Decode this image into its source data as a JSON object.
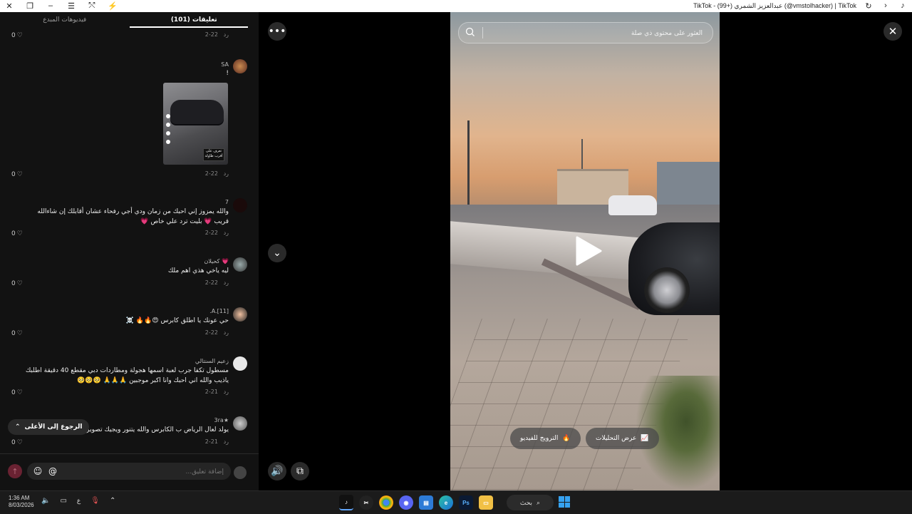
{
  "window": {
    "title": "TikTok - (99+) عبدالعزيز الشمري (@vmstolhacker) | TikTok",
    "buttons": [
      "close",
      "restore",
      "minimize",
      "menu",
      "pin",
      "extension"
    ]
  },
  "comments_panel": {
    "tabs": [
      {
        "label": "(101) تعليقات",
        "active": true
      },
      {
        "label": "فيديوهات المبدع",
        "active": false
      }
    ],
    "comments": [
      {
        "user": "",
        "text": "",
        "date": "2-22",
        "reply": "رد",
        "likes": "0"
      },
      {
        "user": "SA",
        "text": "!",
        "has_image": true,
        "date": "2-22",
        "reply": "رد",
        "likes": "0"
      },
      {
        "user": "7",
        "text": "والله يمزوز إني احبك من زمان ودي أجي رفحاء عشان أقابلك إن شاءالله قريب 💗 بليت ترد علي خاص 💗",
        "date": "2-22",
        "reply": "رد",
        "likes": "0"
      },
      {
        "user": "كحيلان 💗",
        "text": "ليه ياخي هذي اهم ملك",
        "date": "2-22",
        "reply": "رد",
        "likes": "0"
      },
      {
        "user": ".A.[11]",
        "text": "حي عونك يا اطلق كابرس 😍🔥🔥 ☠️",
        "date": "2-22",
        "reply": "رد",
        "likes": "0"
      },
      {
        "user": "زعيم السنتالي",
        "text": "مسطول تكفا جرب لعبة اسمها هجولة ومطاردات دبي مقطع 40 دقيقة اطلبك ياذيب والله اني احبك وانا اكبر موجبين 🙏🙏🙏 🥺🥺🥺",
        "date": "2-21",
        "reply": "رد",
        "likes": "0"
      },
      {
        "user": "3ra★",
        "text": "يولد لعال الرياض ب الكابرس والله يتنور ويجيك تصوير جامد فكر",
        "date": "2-21",
        "reply": "رد",
        "likes": "0"
      }
    ],
    "image_caption": "تعرف على أقرب طاولة",
    "back_to_top": "الرجوع إلى الأعلى",
    "composer": {
      "placeholder": "إضافة تعليق..."
    }
  },
  "video": {
    "search_placeholder": "العثور على محتوى ذي صلة",
    "buttons": {
      "promote": "الترويج للفيديو",
      "analytics": "عرض التحليلات"
    }
  },
  "taskbar": {
    "time": "1:36 AM",
    "date": "8/03/2026",
    "lang": "ع",
    "search_label": "بحث",
    "apps": [
      "tiktok",
      "capcut",
      "chrome",
      "discord",
      "files",
      "edge",
      "photoshop",
      "explorer"
    ]
  },
  "colors": {
    "panel_bg": "#121212",
    "accent": "#fe2c55",
    "send_disabled": "#6a2232"
  }
}
